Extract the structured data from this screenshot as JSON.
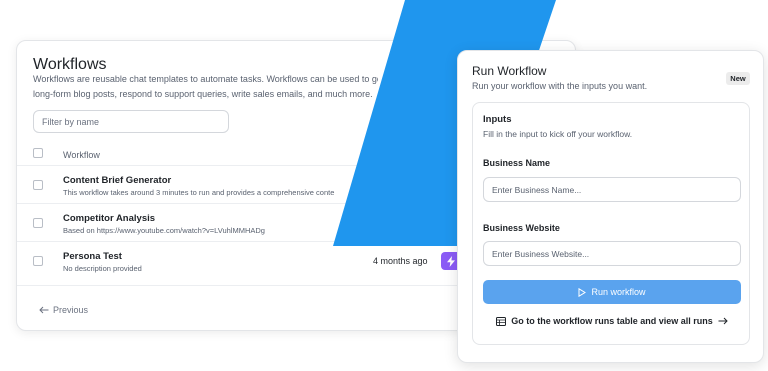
{
  "colors": {
    "accent_blue": "#1f96ee",
    "run_button": "#5aa3ee",
    "run_chip": "#8b5cf6"
  },
  "workflows": {
    "title": "Workflows",
    "description_line1": "Workflows are reusable chat templates to automate tasks. Workflows can be used to gene",
    "description_line2": "long-form blog posts, respond to support queries, write sales emails, and much more.",
    "filter_placeholder": "Filter by name",
    "column_header": "Workflow",
    "rows": [
      {
        "title": "Content Brief Generator",
        "subtitle": "This workflow takes around 3 minutes to run and provides a comprehensive conte",
        "time": ""
      },
      {
        "title": "Competitor Analysis",
        "subtitle": "Based on https://www.youtube.com/watch?v=LVuhlMMHADg",
        "time": ""
      },
      {
        "title": "Persona Test",
        "subtitle": "No description provided",
        "time": "4 months ago",
        "action_icon": "lightning-icon"
      }
    ],
    "previous_label": "Previous"
  },
  "run_panel": {
    "title": "Run Workflow",
    "subtitle": "Run your workflow with the inputs you want.",
    "badge": "New",
    "inputs_title": "Inputs",
    "inputs_subtitle": "Fill in the input to kick off your workflow.",
    "fields": [
      {
        "label": "Business Name",
        "placeholder": "Enter Business Name..."
      },
      {
        "label": "Business Website",
        "placeholder": "Enter Business Website..."
      }
    ],
    "run_button_label": "Run workflow",
    "runs_link_label": "Go to the workflow runs table and view all runs"
  }
}
